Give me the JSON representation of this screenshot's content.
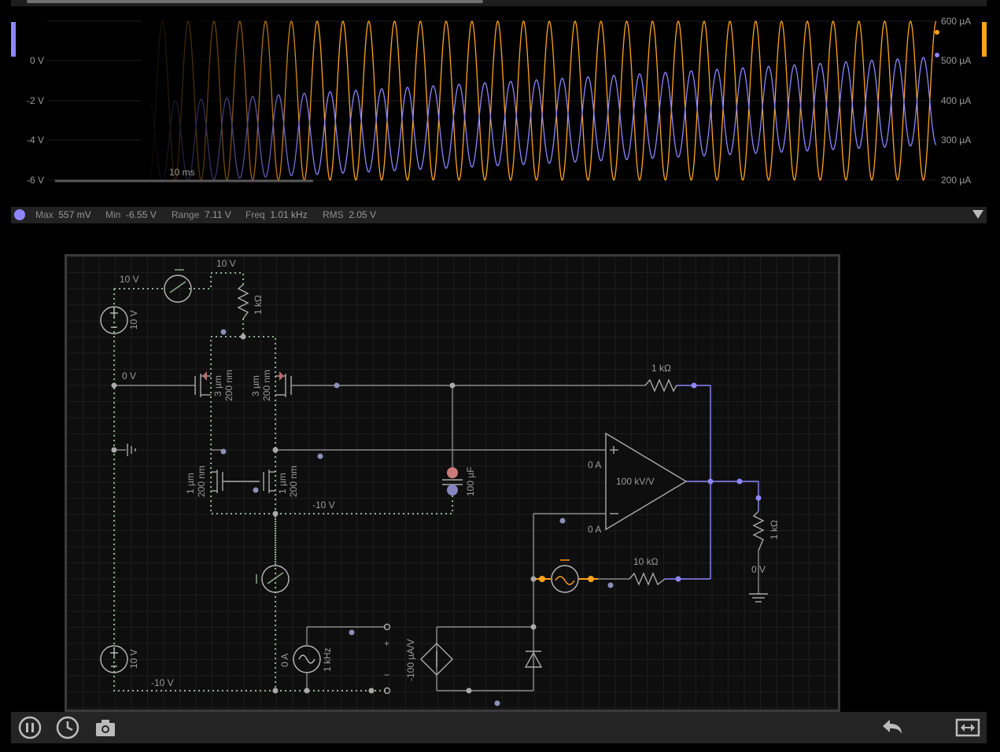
{
  "scope": {
    "left_axis": [
      "0 V",
      "-2 V",
      "-4 V",
      "-6 V"
    ],
    "right_axis": [
      "600 µA",
      "500 µA",
      "400 µA",
      "300 µA",
      "200 µA"
    ],
    "time_scale": "10 ms",
    "channel_colors": {
      "voltage": "#8d86ff",
      "current": "#ffa31a"
    }
  },
  "stats": {
    "max_label": "Max",
    "max_value": "557 mV",
    "min_label": "Min",
    "min_value": "-6.55 V",
    "range_label": "Range",
    "range_value": "7.11 V",
    "freq_label": "Freq",
    "freq_value": "1.01 kHz",
    "rms_label": "RMS",
    "rms_value": "2.05 V"
  },
  "circuit": {
    "labels": {
      "v_top_left": "10 V",
      "v_top_mid": "10 V",
      "r1": "1 kΩ",
      "src_top": "10 V",
      "zero_v": "0 V",
      "m1": "3 µm",
      "m1b": "200 nm",
      "m2": "3 µm",
      "m2b": "200 nm",
      "r_fb": "1 kΩ",
      "m3": "1 µm",
      "m3b": "200 nm",
      "m4": "1 µm",
      "m4b": "200 nm",
      "neg10": "-10 V",
      "cap": "100 µF",
      "opamp_gain": "100 kV/V",
      "ia_plus": "0 A",
      "ia_minus": "0 A",
      "r_load": "1 kΩ",
      "out_v": "0 V",
      "r_in": "10 kΩ",
      "src_bottom": "10 V",
      "neg10b": "-10 V",
      "ac_a": "0 A",
      "ac_f": "1 kHz",
      "vccs": "-100 µA/V",
      "plus": "+",
      "minus": "−"
    }
  },
  "toolbar": {
    "pause": "pause-icon",
    "history": "clock-icon",
    "screenshot": "camera-icon",
    "undo": "undo-icon",
    "fit": "fit-screen-icon"
  }
}
